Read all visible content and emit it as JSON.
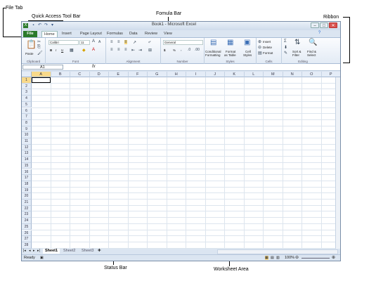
{
  "annotations": {
    "file_tab": "File Tab",
    "quick_access": "Quick Access Tool Bar",
    "formula_bar": "Fomula Bar",
    "ribbon": "Ribbon",
    "status_bar": "Status Bar",
    "worksheet_area": "Worksheet Area"
  },
  "window": {
    "title": "Book1 - Microsoft Excel"
  },
  "tabs": [
    "File",
    "Home",
    "Insert",
    "Page Layout",
    "Formulas",
    "Data",
    "Review",
    "View"
  ],
  "ribbon": {
    "clipboard": {
      "label": "Clipboard",
      "paste": "Paste"
    },
    "font": {
      "label": "Font",
      "name": "Calibri",
      "size": "11",
      "bold": "B",
      "italic": "I",
      "underline": "U"
    },
    "alignment": {
      "label": "Alignment"
    },
    "number": {
      "label": "Number",
      "format": "General",
      "currency": "$",
      "percent": "%"
    },
    "styles": {
      "label": "Styles",
      "cond_1": "Conditional",
      "cond_2": "Formatting",
      "fmt_1": "Format",
      "fmt_2": "as Table",
      "cell_1": "Cell",
      "cell_2": "Styles"
    },
    "cells": {
      "label": "Cells",
      "insert": "Insert",
      "delete": "Delete",
      "format": "Format"
    },
    "editing": {
      "label": "Editing",
      "sort_1": "Sort &",
      "sort_2": "Filter",
      "find_1": "Find &",
      "find_2": "Select"
    }
  },
  "formula_bar": {
    "name_box": "A1",
    "fx": "fx",
    "value": ""
  },
  "columns": [
    "A",
    "B",
    "C",
    "D",
    "E",
    "F",
    "G",
    "H",
    "I",
    "J",
    "K",
    "L",
    "M",
    "N",
    "O",
    "P"
  ],
  "selected_cell": "A1",
  "rows": [
    "1",
    "2",
    "3",
    "4",
    "5",
    "6",
    "7",
    "8",
    "9",
    "10",
    "11",
    "12",
    "13",
    "14",
    "15",
    "16",
    "17",
    "18",
    "19",
    "20",
    "21",
    "22",
    "23",
    "24",
    "25",
    "26",
    "27",
    "28"
  ],
  "sheets": [
    "Sheet1",
    "Sheet2",
    "Sheet3"
  ],
  "active_sheet": "Sheet1",
  "status": {
    "ready": "Ready",
    "zoom": "100%"
  }
}
